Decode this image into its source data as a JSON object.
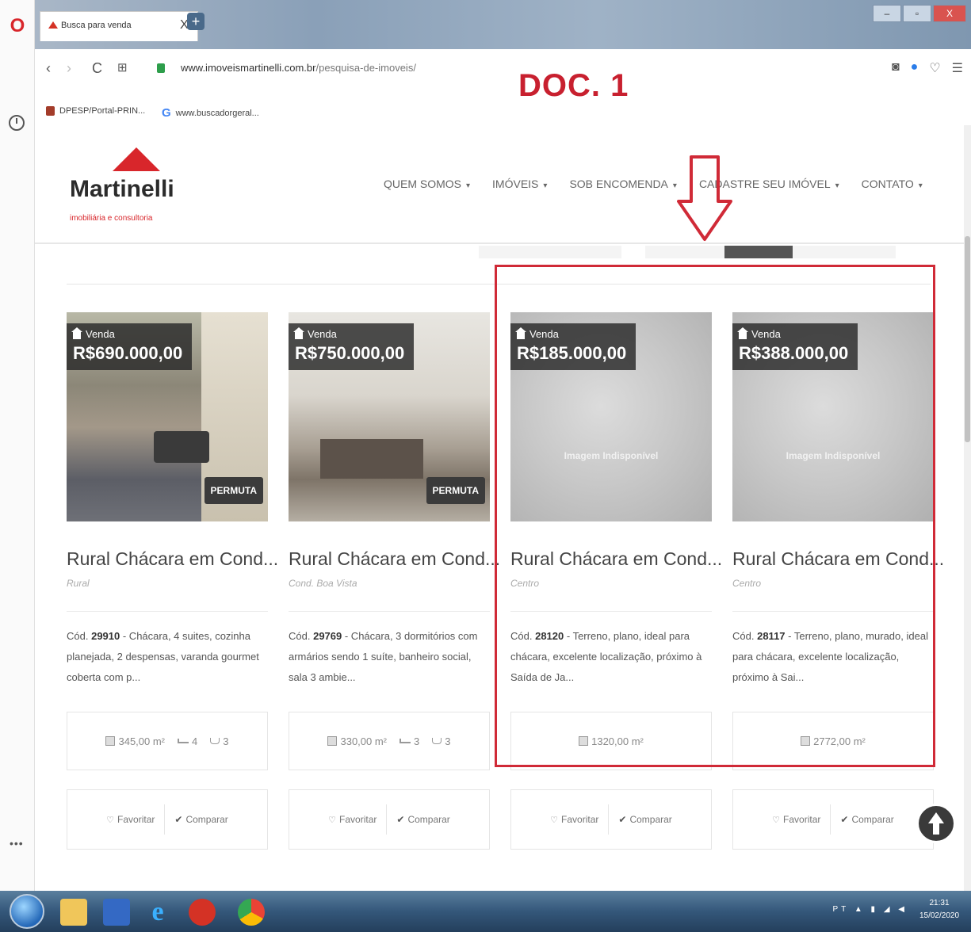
{
  "browser": {
    "tab_title": "Busca para venda",
    "tab_close": "X",
    "new_tab": "+",
    "url_host": "www.imoveismartinelli.com.br",
    "url_path": "/pesquisa-de-imoveis/",
    "bookmarks": [
      "DPESP/Portal-PRIN...",
      "www.buscadorgeral..."
    ],
    "window_buttons": [
      "–",
      "▫",
      "X"
    ]
  },
  "annotation": {
    "doc_label": "DOC. 1"
  },
  "site": {
    "logo_name": "Martinelli",
    "logo_tagline": "imobiliária e consultoria",
    "nav": [
      "QUEM SOMOS",
      "IMÓVEIS",
      "SOB ENCOMENDA",
      "CADASTRE SEU IMÓVEL",
      "CONTATO"
    ]
  },
  "listings": [
    {
      "tag": "Venda",
      "price": "R$690.000,00",
      "badge": "PERMUTA",
      "title": "Rural Chácara em Cond...",
      "location": "Rural",
      "code_prefix": "Cód.",
      "code": "29910",
      "description": " - Chácara, 4 suites, cozinha planejada, 2 despensas, varanda gourmet coberta com p...",
      "area": "345,00 m²",
      "beds": "4",
      "baths": "3",
      "favorite": "Favoritar",
      "compare": "Comparar"
    },
    {
      "tag": "Venda",
      "price": "R$750.000,00",
      "badge": "PERMUTA",
      "title": "Rural Chácara em Cond...",
      "location": "Cond. Boa Vista",
      "code_prefix": "Cód.",
      "code": "29769",
      "description": " - Chácara, 3 dormitórios com armários sendo 1 suíte, banheiro social, sala 3 ambie...",
      "area": "330,00 m²",
      "beds": "3",
      "baths": "3",
      "favorite": "Favoritar",
      "compare": "Comparar"
    },
    {
      "tag": "Venda",
      "price": "R$185.000,00",
      "image_text": "Imagem Indisponível",
      "title": "Rural Chácara em Cond...",
      "location": "Centro",
      "code_prefix": "Cód.",
      "code": "28120",
      "description": " - Terreno, plano, ideal para chácara, excelente localização, próximo à Saída de Ja...",
      "area": "1320,00 m²",
      "favorite": "Favoritar",
      "compare": "Comparar"
    },
    {
      "tag": "Venda",
      "price": "R$388.000,00",
      "image_text": "Imagem Indisponível",
      "title": "Rural Chácara em Cond...",
      "location": "Centro",
      "code_prefix": "Cód.",
      "code": "28117",
      "description": " - Terreno, plano, murado, ideal para chácara, excelente localização, próximo à Sai...",
      "area": "2772,00 m²",
      "favorite": "Favoritar",
      "compare": "Comparar"
    }
  ],
  "taskbar": {
    "tray": "PT",
    "time": "21:31",
    "date": "15/02/2020"
  }
}
